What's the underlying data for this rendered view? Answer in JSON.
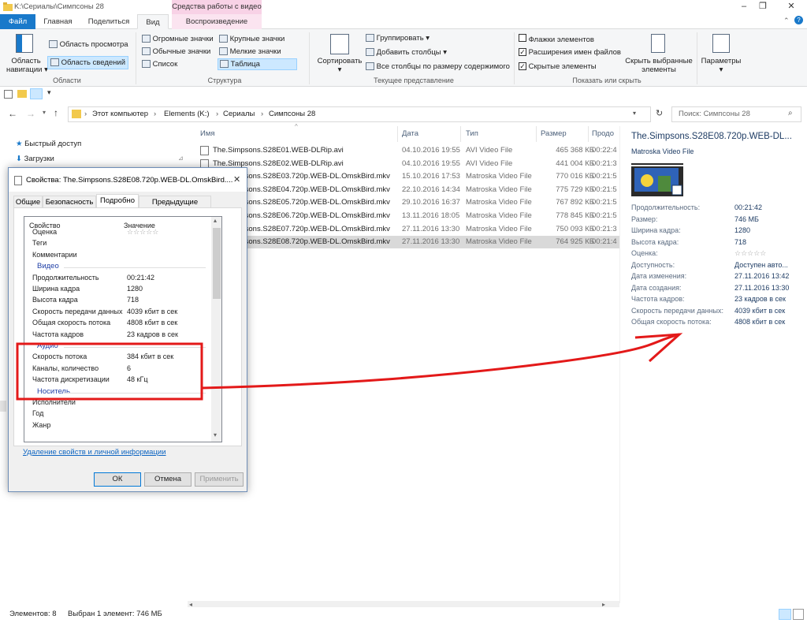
{
  "window": {
    "title": "K:\\Сериалы\\Симпсоны 28",
    "context_tab_header": "Средства работы с видео"
  },
  "tabs": [
    "Файл",
    "Главная",
    "Поделиться",
    "Вид",
    "Воспроизведение"
  ],
  "ribbon": {
    "areas": {
      "nav_pane_line1": "Область",
      "nav_pane_line2": "навигации",
      "preview_pane": "Область просмотра",
      "details_pane": "Область сведений",
      "label": "Области"
    },
    "layout": {
      "huge_icons": "Огромные значки",
      "large_icons": "Крупные значки",
      "normal_icons": "Обычные значки",
      "small_icons": "Мелкие значки",
      "list": "Список",
      "table": "Таблица",
      "label": "Структура"
    },
    "current_view": {
      "sort": "Сортировать",
      "group": "Группировать",
      "add_columns": "Добавить столбцы",
      "fit_columns": "Все столбцы по размеру содержимого",
      "label": "Текущее представление"
    },
    "show_hide": {
      "item_checkboxes": "Флажки элементов",
      "extensions": "Расширения имен файлов",
      "hidden_items": "Скрытые элементы",
      "hide_selected_line1": "Скрыть выбранные",
      "hide_selected_line2": "элементы",
      "label": "Показать или скрыть"
    },
    "options": "Параметры"
  },
  "address": {
    "crumbs": [
      "Этот компьютер",
      "Elements (K:)",
      "Сериалы",
      "Симпсоны 28"
    ],
    "search_placeholder": "Поиск: Симпсоны 28"
  },
  "nav": {
    "quick_access": "Быстрый доступ",
    "downloads": "Загрузки"
  },
  "filelist": {
    "columns": [
      "Имя",
      "Дата",
      "Тип",
      "Размер",
      "Продо"
    ],
    "rows": [
      {
        "name": "The.Simpsons.S28E01.WEB-DLRip.avi",
        "date": "04.10.2016 19:55",
        "type": "AVI Video File",
        "size": "465 368 КБ",
        "dur": "00:22:4"
      },
      {
        "name": "The.Simpsons.S28E02.WEB-DLRip.avi",
        "date": "04.10.2016 19:55",
        "type": "AVI Video File",
        "size": "441 004 КБ",
        "dur": "00:21:3"
      },
      {
        "name": "The.Simpsons.S28E03.720p.WEB-DL.OmskBird.mkv",
        "date": "15.10.2016 17:53",
        "type": "Matroska Video File",
        "size": "770 016 КБ",
        "dur": "00:21:5"
      },
      {
        "name": "The.Simpsons.S28E04.720p.WEB-DL.OmskBird.mkv",
        "date": "22.10.2016 14:34",
        "type": "Matroska Video File",
        "size": "775 729 КБ",
        "dur": "00:21:5"
      },
      {
        "name": "The.Simpsons.S28E05.720p.WEB-DL.OmskBird.mkv",
        "date": "29.10.2016 16:37",
        "type": "Matroska Video File",
        "size": "767 892 КБ",
        "dur": "00:21:5"
      },
      {
        "name": "The.Simpsons.S28E06.720p.WEB-DL.OmskBird.mkv",
        "date": "13.11.2016 18:05",
        "type": "Matroska Video File",
        "size": "778 845 КБ",
        "dur": "00:21:5"
      },
      {
        "name": "The.Simpsons.S28E07.720p.WEB-DL.OmskBird.mkv",
        "date": "27.11.2016 13:30",
        "type": "Matroska Video File",
        "size": "750 093 КБ",
        "dur": "00:21:3"
      },
      {
        "name": "The.Simpsons.S28E08.720p.WEB-DL.OmskBird.mkv",
        "date": "27.11.2016 13:30",
        "type": "Matroska Video File",
        "size": "764 925 КБ",
        "dur": "00:21:4"
      }
    ],
    "selected_index": 7
  },
  "preview": {
    "title": "The.Simpsons.S28E08.720p.WEB-DL...",
    "type": "Matroska Video File",
    "rows": [
      {
        "label": "Продолжительность:",
        "value": "00:21:42"
      },
      {
        "label": "Размер:",
        "value": "746 МБ"
      },
      {
        "label": "Ширина кадра:",
        "value": "1280"
      },
      {
        "label": "Высота кадра:",
        "value": "718"
      },
      {
        "label": "Оценка:",
        "value": "☆☆☆☆☆"
      },
      {
        "label": "Доступность:",
        "value": "Доступен авто..."
      },
      {
        "label": "Дата изменения:",
        "value": "27.11.2016 13:42"
      },
      {
        "label": "Дата создания:",
        "value": "27.11.2016 13:30"
      },
      {
        "label": "Частота кадров:",
        "value": "23 кадров в сек"
      },
      {
        "label": "Скорость передачи данных:",
        "value": "4039 кбит в сек"
      },
      {
        "label": "Общая скорость потока:",
        "value": "4808 кбит в сек"
      }
    ]
  },
  "status": {
    "items_count": "Элементов: 8",
    "selected": "Выбран 1 элемент: 746 МБ"
  },
  "dialog": {
    "title": "Свойства: The.Simpsons.S28E08.720p.WEB-DL.OmskBird....",
    "tabs": [
      "Общие",
      "Безопасность",
      "Подробно",
      "Предыдущие версии"
    ],
    "active_tab": "Подробно",
    "col_property": "Свойство",
    "col_value": "Значение",
    "rows": [
      {
        "kind": "prop",
        "name": "Оценка",
        "value": "☆☆☆☆☆"
      },
      {
        "kind": "prop",
        "name": "Теги",
        "value": ""
      },
      {
        "kind": "prop",
        "name": "Комментарии",
        "value": ""
      },
      {
        "kind": "section",
        "name": "Видео"
      },
      {
        "kind": "prop",
        "name": "Продолжительность",
        "value": "00:21:42"
      },
      {
        "kind": "prop",
        "name": "Ширина кадра",
        "value": "1280"
      },
      {
        "kind": "prop",
        "name": "Высота кадра",
        "value": "718"
      },
      {
        "kind": "prop",
        "name": "Скорость передачи данных",
        "value": "4039 кбит в сек"
      },
      {
        "kind": "prop",
        "name": "Общая скорость потока",
        "value": "4808 кбит в сек"
      },
      {
        "kind": "prop",
        "name": "Частота кадров",
        "value": "23 кадров в сек"
      },
      {
        "kind": "section",
        "name": "Аудио"
      },
      {
        "kind": "prop",
        "name": "Скорость потока",
        "value": "384 кбит в сек"
      },
      {
        "kind": "prop",
        "name": "Каналы, количество",
        "value": "6"
      },
      {
        "kind": "prop",
        "name": "Частота дискретизации",
        "value": "48 кГц"
      },
      {
        "kind": "section",
        "name": "Носитель"
      },
      {
        "kind": "prop",
        "name": "Исполнители",
        "value": ""
      },
      {
        "kind": "prop",
        "name": "Год",
        "value": ""
      },
      {
        "kind": "prop",
        "name": "Жанр",
        "value": ""
      }
    ],
    "remove_link": "Удаление свойств и личной информации",
    "ok": "ОК",
    "cancel": "Отмена",
    "apply": "Применить"
  },
  "colors": {
    "accent_file_tab": "#1979ca",
    "context_tab": "#f8d2e6",
    "annotation": "#e31919"
  }
}
